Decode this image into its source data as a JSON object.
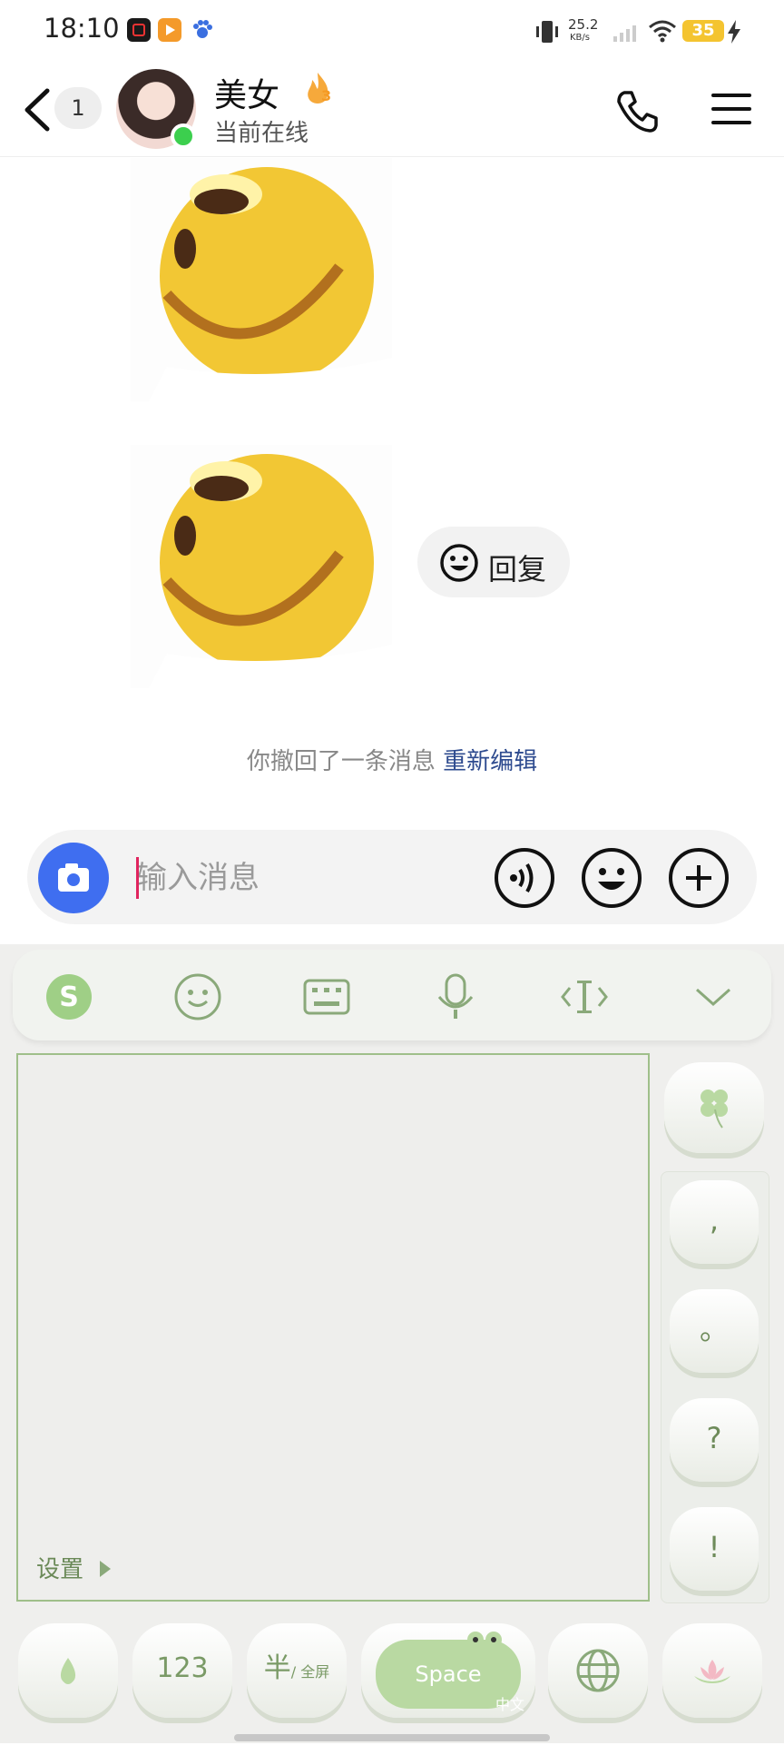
{
  "status_bar": {
    "time": "18:10",
    "net_speed": "25.2",
    "net_unit": "KB/s",
    "battery": "35"
  },
  "header": {
    "unread_count": "1",
    "contact_name": "美女",
    "streak_count": "3",
    "online_status": "当前在线"
  },
  "chat": {
    "reply_label": "回复",
    "recall_text": "你撤回了一条消息",
    "recall_action": "重新编辑"
  },
  "input": {
    "placeholder": "输入消息"
  },
  "keyboard": {
    "settings_label": "设置",
    "side_keys": [
      ",",
      "。",
      "?",
      "!"
    ],
    "num_key": "123",
    "half_full_key": "半",
    "half_full_sub": "/ 全屏",
    "space_label": "Space",
    "space_sub": "中文"
  },
  "colors": {
    "accent_blue": "#3f6ef0",
    "online_green": "#3ccf4e",
    "keyboard_green": "#b9d9a2",
    "link_blue": "#2e4b8f"
  }
}
